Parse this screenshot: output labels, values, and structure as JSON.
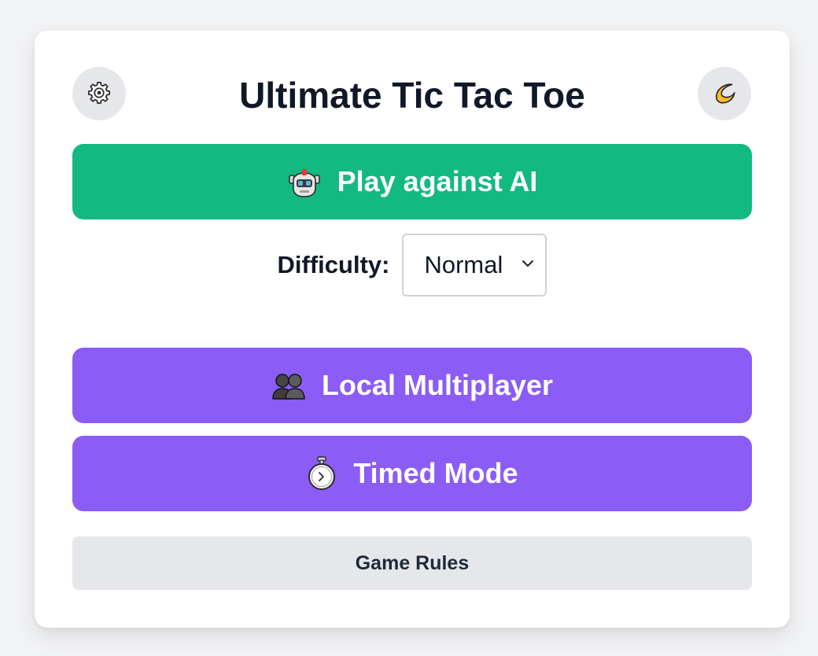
{
  "header": {
    "title": "Ultimate Tic Tac Toe",
    "settings_icon": "gear-icon",
    "theme_icon": "crescent-moon-icon"
  },
  "modes": {
    "ai": {
      "label": "Play against AI",
      "icon": "robot-icon",
      "color": "#12b981"
    },
    "local": {
      "label": "Local Multiplayer",
      "icon": "two-people-icon",
      "color": "#8b5cf6"
    },
    "timed": {
      "label": "Timed Mode",
      "icon": "stopwatch-icon",
      "color": "#8b5cf6"
    }
  },
  "difficulty": {
    "label": "Difficulty:",
    "selected": "Normal"
  },
  "rules": {
    "label": "Game Rules"
  }
}
